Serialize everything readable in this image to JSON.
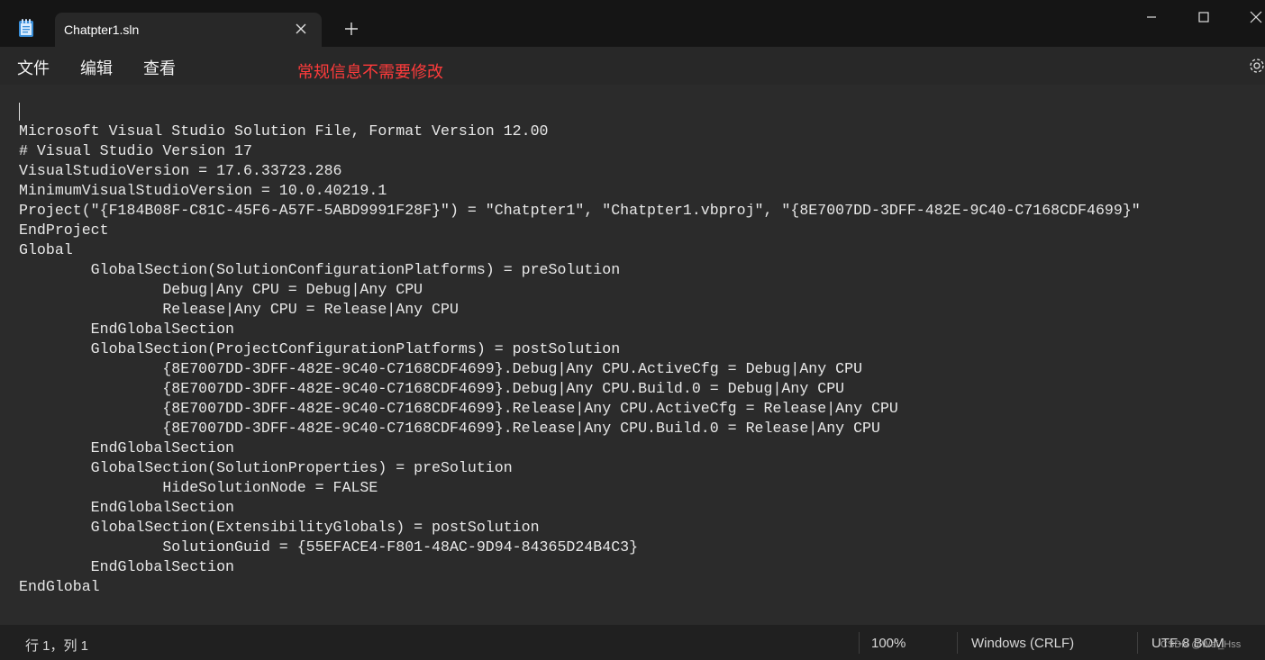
{
  "tab": {
    "title": "Chatpter1.sln"
  },
  "menu": {
    "file": "文件",
    "edit": "编辑",
    "view": "查看"
  },
  "annotation": "常规信息不需要修改",
  "editor": {
    "text": "Microsoft Visual Studio Solution File, Format Version 12.00\n# Visual Studio Version 17\nVisualStudioVersion = 17.6.33723.286\nMinimumVisualStudioVersion = 10.0.40219.1\nProject(\"{F184B08F-C81C-45F6-A57F-5ABD9991F28F}\") = \"Chatpter1\", \"Chatpter1.vbproj\", \"{8E7007DD-3DFF-482E-9C40-C7168CDF4699}\"\nEndProject\nGlobal\n        GlobalSection(SolutionConfigurationPlatforms) = preSolution\n                Debug|Any CPU = Debug|Any CPU\n                Release|Any CPU = Release|Any CPU\n        EndGlobalSection\n        GlobalSection(ProjectConfigurationPlatforms) = postSolution\n                {8E7007DD-3DFF-482E-9C40-C7168CDF4699}.Debug|Any CPU.ActiveCfg = Debug|Any CPU\n                {8E7007DD-3DFF-482E-9C40-C7168CDF4699}.Debug|Any CPU.Build.0 = Debug|Any CPU\n                {8E7007DD-3DFF-482E-9C40-C7168CDF4699}.Release|Any CPU.ActiveCfg = Release|Any CPU\n                {8E7007DD-3DFF-482E-9C40-C7168CDF4699}.Release|Any CPU.Build.0 = Release|Any CPU\n        EndGlobalSection\n        GlobalSection(SolutionProperties) = preSolution\n                HideSolutionNode = FALSE\n        EndGlobalSection\n        GlobalSection(ExtensibilityGlobals) = postSolution\n                SolutionGuid = {55EFACE4-F801-48AC-9D94-84365D24B4C3}\n        EndGlobalSection\nEndGlobal"
  },
  "status": {
    "position": "行 1，列 1",
    "zoom": "100%",
    "line_ending": "Windows (CRLF)",
    "encoding": "UTF-8 BOM"
  },
  "watermark": "CSDN @Wei_Hss",
  "icons": {
    "app": "notepad-icon",
    "close_tab": "close-icon",
    "new_tab": "plus-icon",
    "minimize": "minimize-icon",
    "maximize": "maximize-icon",
    "close_window": "close-window-icon",
    "settings": "gear-icon"
  },
  "colors": {
    "annotation": "#ff3b3b",
    "editor_bg": "#2b2b2b",
    "titlebar_bg": "#151515"
  }
}
